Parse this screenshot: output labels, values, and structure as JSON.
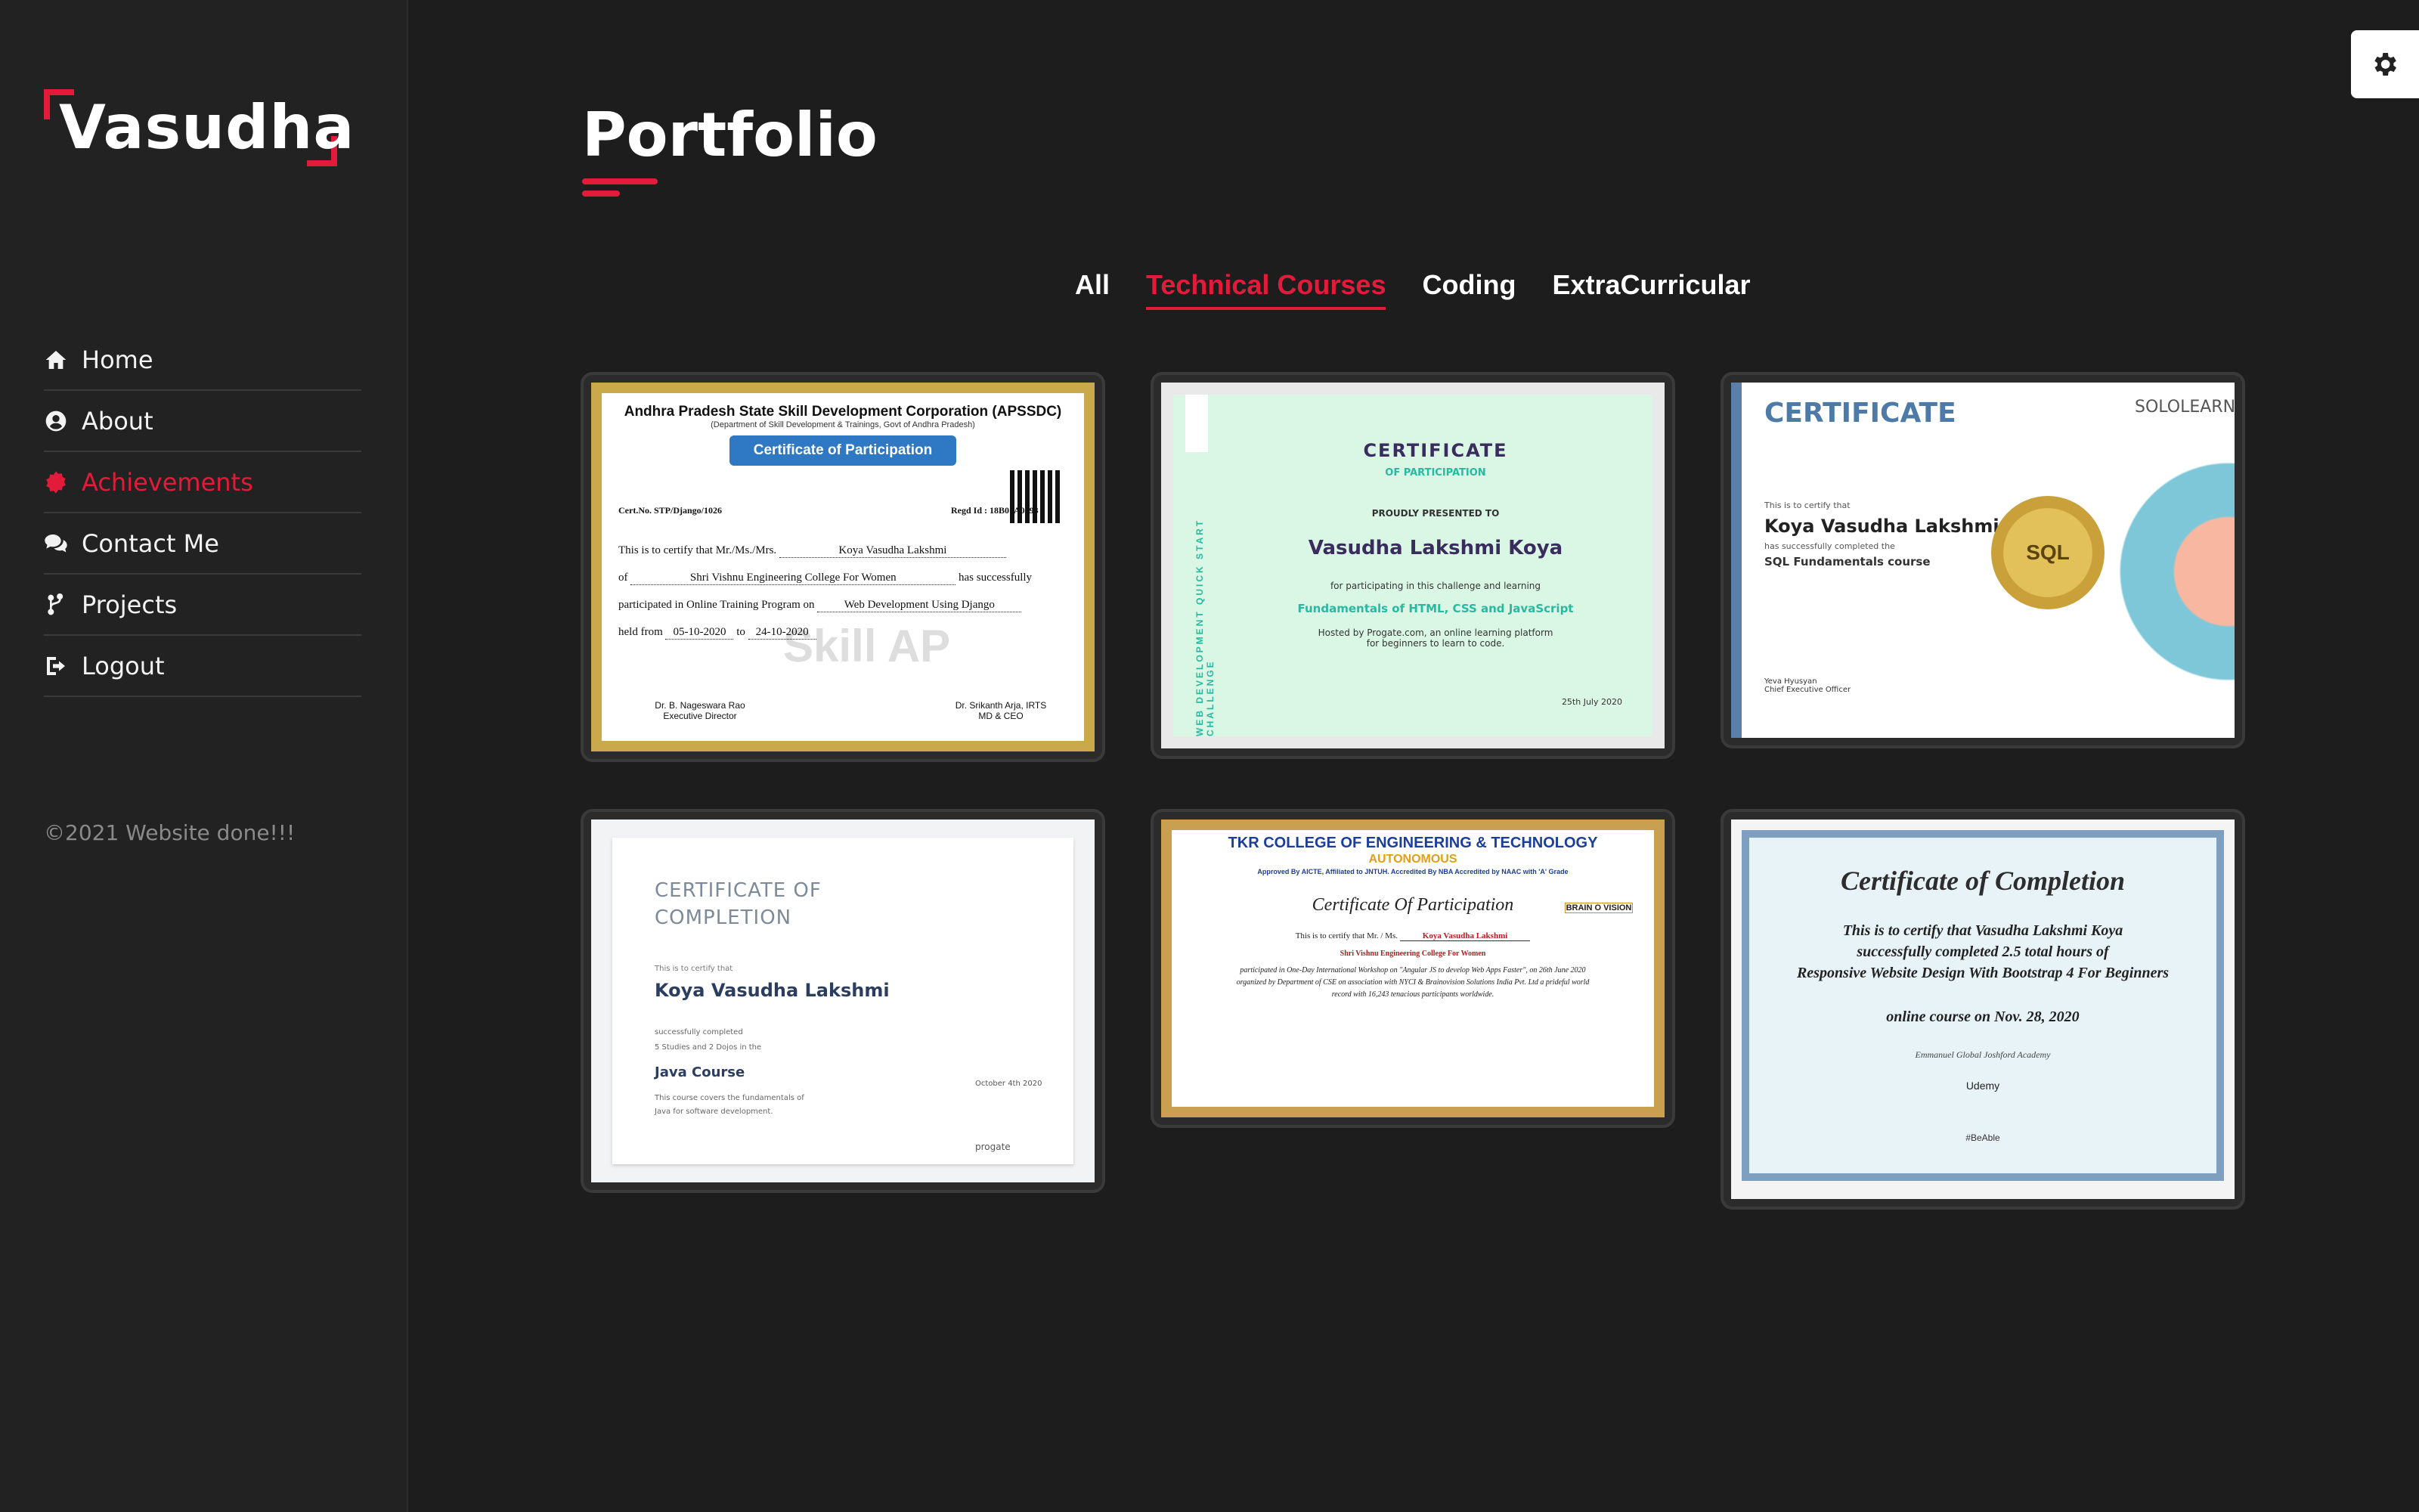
{
  "brand": {
    "name": "Vasudha"
  },
  "nav": {
    "items": [
      {
        "label": "Home",
        "icon": "home-icon"
      },
      {
        "label": "About",
        "icon": "user-circle-icon"
      },
      {
        "label": "Achievements",
        "icon": "badge-icon"
      },
      {
        "label": "Contact Me",
        "icon": "comments-icon"
      },
      {
        "label": "Projects",
        "icon": "code-branch-icon"
      },
      {
        "label": "Logout",
        "icon": "sign-out-icon"
      }
    ],
    "active": "Achievements"
  },
  "footer": {
    "copyright": "©2021 Website done!!!"
  },
  "settings": {
    "icon": "gear-icon"
  },
  "page": {
    "title": "Portfolio"
  },
  "filters": {
    "items": [
      "All",
      "Technical Courses",
      "Coding",
      "ExtraCurricular"
    ],
    "active": "Technical Courses"
  },
  "certificates": [
    {
      "org": "Andhra Pradesh State Skill Development Corporation (APSSDC)",
      "org_sub": "(Department of Skill Development & Trainings, Govt of Andhra Pradesh)",
      "title": "Certificate of Participation",
      "cert_no": "Cert.No. STP/Django/1026",
      "regd_id": "Regd Id : 18B01A0593",
      "line1_prefix": "This is to certify that Mr./Ms./Mrs.",
      "name": "Koya Vasudha Lakshmi",
      "line2_prefix": "of",
      "college": "Shri Vishnu Engineering College For Women",
      "line2_suffix": "has successfully",
      "line3_prefix": "participated in Online Training Program on",
      "program": "Web Development Using Django",
      "line4_prefix": "held from",
      "from": "05-10-2020",
      "to_word": "to",
      "to": "24-10-2020",
      "sig1": "Dr. B. Nageswara Rao\nExecutive Director",
      "sig2": "Dr. Srikanth Arja, IRTS\nMD & CEO",
      "watermark": "Skill AP"
    },
    {
      "title": "CERTIFICATE",
      "subtitle": "OF PARTICIPATION",
      "presented": "PROUDLY PRESENTED TO",
      "name": "Vasudha Lakshmi Koya",
      "for": "for participating in this challenge and learning",
      "course": "Fundamentals of HTML, CSS and JavaScript",
      "hosted": "Hosted by Progate.com, an online learning platform\nfor beginners to learn to code.",
      "date": "25th July 2020",
      "side": "WEB DEVELOPMENT QUICK START CHALLENGE"
    },
    {
      "title": "CERTIFICATE",
      "brand": "SOLOLEARN",
      "certify": "This is to certify that",
      "name": "Koya Vasudha Lakshmi",
      "completed": "has successfully completed the",
      "course": "SQL Fundamentals course",
      "seal": "SQL",
      "signer": "Yeva Hyusyan\nChief Executive Officer"
    },
    {
      "title": "CERTIFICATE OF\nCOMPLETION",
      "certify": "This is to certify that",
      "name": "Koya Vasudha Lakshmi",
      "completed": "successfully completed\n5 Studies and 2 Dojos in the",
      "course": "Java Course",
      "desc": "This course covers the fundamentals of\nJava for software development.",
      "date": "October 4th 2020",
      "brand": "progate"
    },
    {
      "college": "TKR COLLEGE OF ENGINEERING & TECHNOLOGY",
      "autonomous": "AUTONOMOUS",
      "approved": "Approved By AICTE, Affiliated to JNTUH. Accredited By NBA Accredited by NAAC with 'A' Grade",
      "title": "Certificate Of Participation",
      "certify": "This is to certify that Mr. / Ms.",
      "name": "Koya Vasudha Lakshmi",
      "from_college": "Shri Vishnu Engineering College For Women",
      "body": "participated in One-Day International Workshop on \"Angular JS to develop Web Apps Faster\", on 26th June 2020 organized by Department of CSE on association with NYCI & Brainovision Solutions India Pvt. Ltd a prideful world record with 16,243 tenacious participants worldwide.",
      "brand": "BRAIN O VISION"
    },
    {
      "title": "Certificate of Completion",
      "line1": "This is to certify that Vasudha Lakshmi Koya",
      "line2": "successfully completed 2.5 total hours of",
      "course": "Responsive Website Design With Bootstrap 4 For Beginners",
      "line3": "online course on Nov. 28, 2020",
      "instructors": "Emmanuel Global  Joshford Academy",
      "brand": "Udemy",
      "badge": "#BeAble"
    }
  ]
}
